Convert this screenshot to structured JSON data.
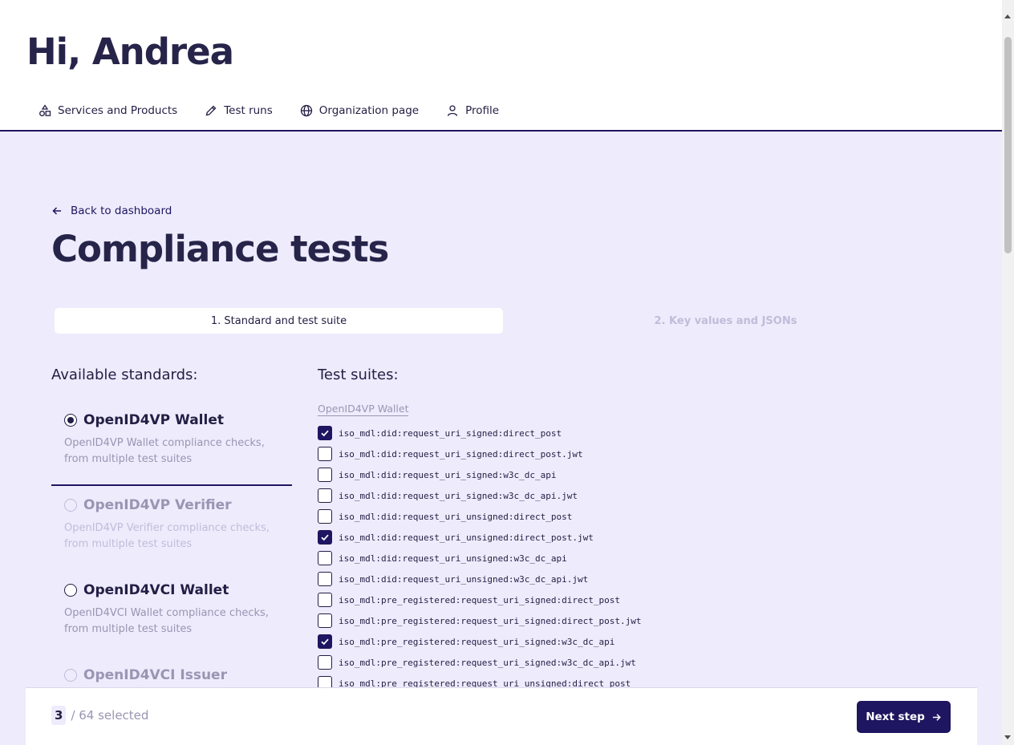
{
  "header": {
    "greeting": "Hi, Andrea",
    "nav": [
      {
        "label": "Services and Products",
        "icon": "shapes-icon"
      },
      {
        "label": "Test runs",
        "icon": "pencil-icon"
      },
      {
        "label": "Organization page",
        "icon": "globe-icon"
      },
      {
        "label": "Profile",
        "icon": "user-icon"
      }
    ]
  },
  "main": {
    "back_label": "Back to dashboard",
    "title": "Compliance tests",
    "steps": [
      "1. Standard and test suite",
      "2. Key values and JSONs"
    ],
    "standards_heading": "Available standards:",
    "suites_heading": "Test suites:",
    "standards": [
      {
        "name": "OpenID4VP Wallet",
        "desc": "OpenID4VP Wallet compliance checks, from multiple test suites",
        "selected": true,
        "disabled": false
      },
      {
        "name": "OpenID4VP Verifier",
        "desc": "OpenID4VP Verifier compliance checks, from multiple test suites",
        "selected": false,
        "disabled": true
      },
      {
        "name": "OpenID4VCI Wallet",
        "desc": "OpenID4VCI Wallet compliance checks, from multiple test suites",
        "selected": false,
        "disabled": false
      },
      {
        "name": "OpenID4VCI Issuer",
        "desc": "",
        "selected": false,
        "disabled": true
      }
    ],
    "suite_group": "OpenID4VP Wallet",
    "suites": [
      {
        "name": "iso_mdl:did:request_uri_signed:direct_post",
        "checked": true
      },
      {
        "name": "iso_mdl:did:request_uri_signed:direct_post.jwt",
        "checked": false
      },
      {
        "name": "iso_mdl:did:request_uri_signed:w3c_dc_api",
        "checked": false
      },
      {
        "name": "iso_mdl:did:request_uri_signed:w3c_dc_api.jwt",
        "checked": false
      },
      {
        "name": "iso_mdl:did:request_uri_unsigned:direct_post",
        "checked": false
      },
      {
        "name": "iso_mdl:did:request_uri_unsigned:direct_post.jwt",
        "checked": true
      },
      {
        "name": "iso_mdl:did:request_uri_unsigned:w3c_dc_api",
        "checked": false
      },
      {
        "name": "iso_mdl:did:request_uri_unsigned:w3c_dc_api.jwt",
        "checked": false
      },
      {
        "name": "iso_mdl:pre_registered:request_uri_signed:direct_post",
        "checked": false
      },
      {
        "name": "iso_mdl:pre_registered:request_uri_signed:direct_post.jwt",
        "checked": false
      },
      {
        "name": "iso_mdl:pre_registered:request_uri_signed:w3c_dc_api",
        "checked": true
      },
      {
        "name": "iso_mdl:pre_registered:request_uri_signed:w3c_dc_api.jwt",
        "checked": false
      },
      {
        "name": "iso_mdl:pre_registered:request_uri_unsigned:direct_post",
        "checked": false
      }
    ]
  },
  "footer": {
    "selected_count": "3",
    "total_text": "/ 64 selected",
    "next_label": "Next step"
  },
  "colors": {
    "brand": "#1e1660",
    "background": "#eeebfc",
    "muted": "#9995b3"
  }
}
